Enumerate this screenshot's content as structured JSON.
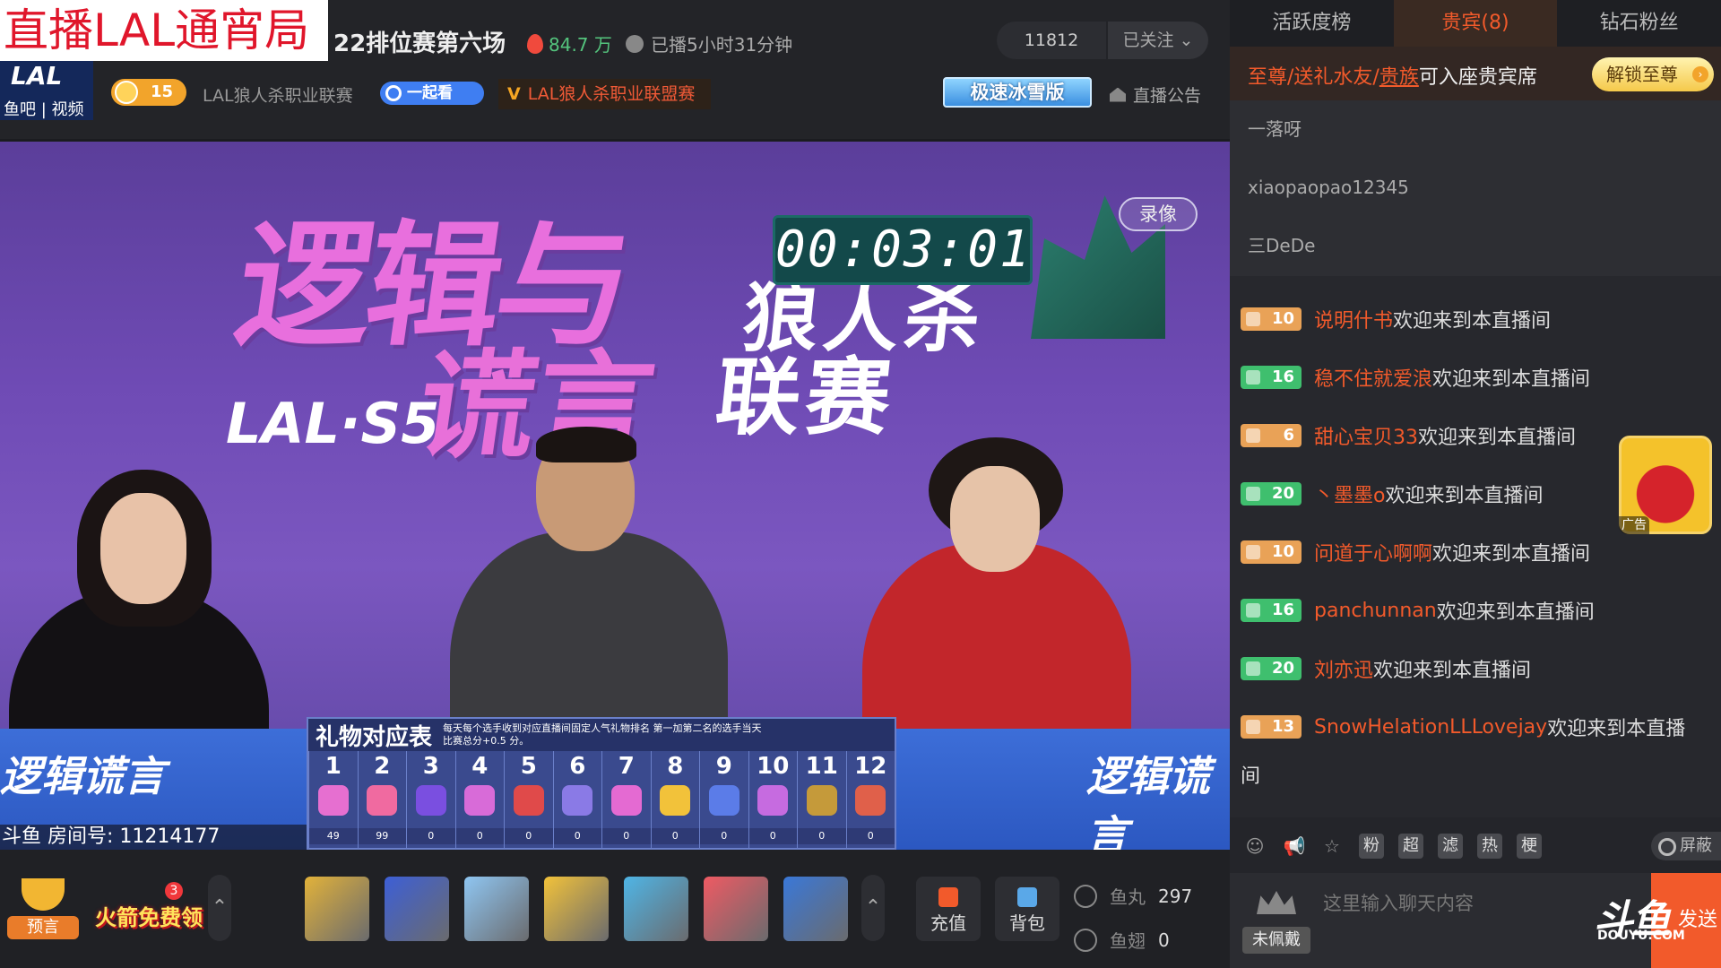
{
  "overlay": {
    "title": "直播LAL通宵局"
  },
  "logo": {
    "text": "LAL",
    "links": "鱼吧 | 视频"
  },
  "header": {
    "stream_title": "22排位赛第六场",
    "hot_value": "84.7 万",
    "duration": "已播5小时31分钟",
    "follow_count": "11812",
    "follow_label": "已关注",
    "level": "15",
    "category": "LAL狼人杀职业联赛",
    "watch_together": "一起看",
    "league_tag_prefix": "V",
    "league_tag": "LAL狼人杀职业联盟赛",
    "ice_badge": "极速冰雪版",
    "announcement": "直播公告"
  },
  "video": {
    "bg_title_1": "逻辑与",
    "bg_title_2": "谎言",
    "bg_lal": "LAL·S5",
    "bg_right_1": "狼人杀",
    "bg_right_2": "联赛",
    "timer": "00:03:01",
    "record_label": "录像",
    "desk_logo": "逻辑谎言",
    "room_number": "斗鱼 房间号: 11214177",
    "gift_table": {
      "title": "礼物对应表",
      "note": "每天每个选手收到对应直播间固定人气礼物排名 第一加第二名的选手当天比赛总分+0.5 分。",
      "columns": [
        {
          "num": "1",
          "value": "49",
          "color": "#e66fd0"
        },
        {
          "num": "2",
          "value": "99",
          "color": "#f06aa0"
        },
        {
          "num": "3",
          "value": "0",
          "color": "#7a4fe0"
        },
        {
          "num": "4",
          "value": "0",
          "color": "#d86bd8"
        },
        {
          "num": "5",
          "value": "0",
          "color": "#e04a4a"
        },
        {
          "num": "6",
          "value": "0",
          "color": "#8a7ae6"
        },
        {
          "num": "7",
          "value": "0",
          "color": "#e46ad2"
        },
        {
          "num": "8",
          "value": "0",
          "color": "#f2c23a"
        },
        {
          "num": "9",
          "value": "0",
          "color": "#5b7ce8"
        },
        {
          "num": "10",
          "value": "0",
          "color": "#c66be0"
        },
        {
          "num": "11",
          "value": "0",
          "color": "#c59a3a"
        },
        {
          "num": "12",
          "value": "0",
          "color": "#e0604a"
        }
      ]
    }
  },
  "bottom": {
    "forecast": "预言",
    "rocket_free": "火箭免费领",
    "rocket_badge": "3",
    "gifts": [
      {
        "name": "rocket-gold",
        "color": "#e2b23a"
      },
      {
        "name": "rocket-red",
        "color": "#3d5fd6"
      },
      {
        "name": "plane",
        "color": "#8fc6f2"
      },
      {
        "name": "gold-card",
        "color": "#f2c23a"
      },
      {
        "name": "ticket",
        "color": "#4fb5e6"
      },
      {
        "name": "heart-card",
        "color": "#ef5a63"
      },
      {
        "name": "ice-cubes",
        "color": "#3a78d8"
      }
    ],
    "recharge": "充值",
    "backpack": "背包",
    "fish_ball_label": "鱼丸",
    "fish_ball_value": "297",
    "fish_fin_label": "鱼翅",
    "fish_fin_value": "0"
  },
  "panel": {
    "tabs": [
      "活跃度榜",
      "贵宾(8)",
      "钻石粉丝"
    ],
    "vip_banner": {
      "highlight": "至尊/送礼水友/",
      "underlined": "贵族",
      "normal": "可入座贵宾席",
      "unlock": "解锁至尊"
    },
    "vip_users": [
      "一落呀",
      "xiaopaopao12345",
      "三DeDe"
    ],
    "chat": [
      {
        "level": "10",
        "badge": "orange",
        "nick": "说明什书",
        "text": "欢迎来到本直播间"
      },
      {
        "level": "16",
        "badge": "green",
        "nick": "稳不住就爱浪",
        "text": "欢迎来到本直播间"
      },
      {
        "level": "6",
        "badge": "orange",
        "nick": "甜心宝贝33",
        "text": "欢迎来到本直播间"
      },
      {
        "level": "20",
        "badge": "green",
        "nick": "丶墨墨o",
        "text": "欢迎来到本直播间"
      },
      {
        "level": "10",
        "badge": "orange",
        "nick": "问道于心啊啊",
        "text": "欢迎来到本直播间"
      },
      {
        "level": "16",
        "badge": "green",
        "nick": "panchunnan",
        "text": "欢迎来到本直播间"
      },
      {
        "level": "20",
        "badge": "green",
        "nick": "刘亦迅",
        "text": "欢迎来到本直播间"
      },
      {
        "level": "13",
        "badge": "orange",
        "nick": "SnowHelationLLLovejay",
        "text": "欢迎来到本直播"
      }
    ],
    "chat_wrap": "间",
    "ad_tag": "广告",
    "tools": [
      "粉",
      "超",
      "滤",
      "热",
      "梗"
    ],
    "shield": "屏蔽",
    "unworn": "未佩戴",
    "input_placeholder": "这里输入聊天内容",
    "send": "发送",
    "watermark": "斗鱼",
    "watermark_sub": "DOUYU.COM"
  }
}
